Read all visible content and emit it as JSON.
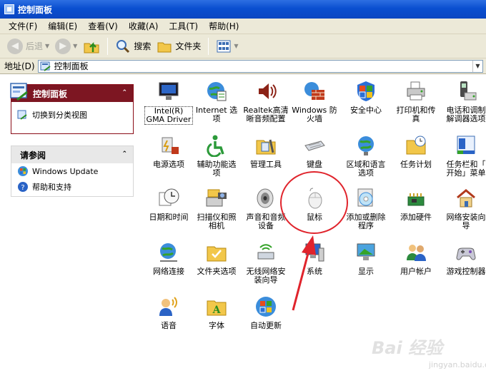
{
  "window": {
    "title": "控制面板"
  },
  "menu": [
    "文件(F)",
    "编辑(E)",
    "查看(V)",
    "收藏(A)",
    "工具(T)",
    "帮助(H)"
  ],
  "toolbar": {
    "back": "后退",
    "search": "搜索",
    "folders": "文件夹"
  },
  "address": {
    "label": "地址(D)",
    "value": "控制面板"
  },
  "left_panel": {
    "control_panel": {
      "title": "控制面板",
      "link": "切换到分类视图"
    },
    "see_also": {
      "title": "请参阅",
      "links": [
        "Windows Update",
        "帮助和支持"
      ]
    }
  },
  "items": [
    "Intel(R)\nGMA Driver",
    "Internet 选\n项",
    "Realtek高清\n晰音频配置",
    "Windows 防\n火墙",
    "安全中心",
    "打印机和传\n真",
    "电话和调制\n解调器选项",
    "电源选项",
    "辅助功能选\n项",
    "管理工具",
    "键盘",
    "区域和语言\n选项",
    "任务计划",
    "任务栏和「\n开始」菜单",
    "日期和时间",
    "扫描仪和照\n相机",
    "声音和音频\n设备",
    "鼠标",
    "添加或删除\n程序",
    "添加硬件",
    "网络安装向\n导",
    "网络连接",
    "文件夹选项",
    "无线网络安\n装向导",
    "系统",
    "显示",
    "用户帐户",
    "游戏控制器",
    "语音",
    "字体",
    "自动更新"
  ],
  "watermark": {
    "text": "Bai 经验",
    "sub": "jingyan.baidu.com"
  },
  "colors": {
    "title_bar": "#0a4fd0",
    "panel_header": "#7d1622",
    "annotation": "#e0242c"
  }
}
